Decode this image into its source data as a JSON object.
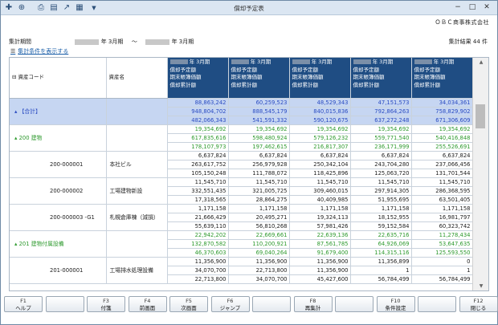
{
  "window": {
    "title": "償却予定表",
    "company": "ＯＢＣ商事株式会社"
  },
  "toolbar": {
    "icons": [
      "add-icon",
      "zoom-icon",
      "print-icon",
      "export-icon",
      "chart-icon",
      "settings-icon",
      "menu-icon"
    ]
  },
  "period": {
    "label": "集計期間",
    "from_suffix": "年  3月期",
    "separator": "～",
    "to_suffix": "年  3月期"
  },
  "result_count": "集計結果 44 件",
  "condition_link": "集計条件を表示する",
  "columns": {
    "code": "資産コード",
    "name": "資産名",
    "period_header": "年  3月期",
    "line1": "償却予定額",
    "line2": "期末帳簿価額",
    "line3": "償却累計額"
  },
  "rows": [
    {
      "type": "total",
      "code": "【合計】",
      "name": "",
      "values": [
        [
          "88,863,242",
          "60,259,523",
          "48,529,343",
          "47,151,573",
          "34,034,361"
        ],
        [
          "948,804,702",
          "888,545,179",
          "840,015,836",
          "792,864,263",
          "758,829,902"
        ],
        [
          "482,066,343",
          "541,591,332",
          "590,120,675",
          "637,272,248",
          "671,306,609"
        ]
      ]
    },
    {
      "type": "grp",
      "code": "200 建物",
      "name": "",
      "values": [
        [
          "19,354,692",
          "19,354,692",
          "19,354,692",
          "19,354,692",
          "19,354,692"
        ],
        [
          "617,835,616",
          "598,480,924",
          "579,126,232",
          "559,771,540",
          "540,416,848"
        ],
        [
          "178,107,973",
          "197,462,615",
          "216,817,307",
          "236,171,999",
          "255,526,691"
        ]
      ]
    },
    {
      "type": "item",
      "code": "200-000001",
      "name": "本社ビル",
      "values": [
        [
          "6,637,824",
          "6,637,824",
          "6,637,824",
          "6,637,824",
          "6,637,824"
        ],
        [
          "263,617,752",
          "256,979,928",
          "250,342,104",
          "243,704,280",
          "237,066,456"
        ],
        [
          "105,150,248",
          "111,788,072",
          "118,425,896",
          "125,063,720",
          "131,701,544"
        ]
      ]
    },
    {
      "type": "item",
      "code": "200-000002",
      "name": "工場建物新設",
      "values": [
        [
          "11,545,710",
          "11,545,710",
          "11,545,710",
          "11,545,710",
          "11,545,710"
        ],
        [
          "332,551,435",
          "321,005,725",
          "309,460,015",
          "297,914,305",
          "286,368,595"
        ],
        [
          "17,318,565",
          "28,864,275",
          "40,409,985",
          "51,955,695",
          "63,501,405"
        ]
      ]
    },
    {
      "type": "item",
      "code": "200-000003 -G1",
      "name": "札幌倉庫棟（減損）",
      "values": [
        [
          "1,171,158",
          "1,171,158",
          "1,171,158",
          "1,171,158",
          "1,171,158"
        ],
        [
          "21,666,429",
          "20,495,271",
          "19,324,113",
          "18,152,955",
          "16,981,797"
        ],
        [
          "55,639,110",
          "56,810,268",
          "57,981,426",
          "59,152,584",
          "60,323,742"
        ]
      ]
    },
    {
      "type": "grp",
      "code": "201 建物付属設備",
      "name": "",
      "values": [
        [
          "22,942,202",
          "22,669,661",
          "22,639,136",
          "22,635,716",
          "11,278,434"
        ],
        [
          "132,870,582",
          "110,200,921",
          "87,561,785",
          "64,926,069",
          "53,647,635"
        ],
        [
          "46,370,603",
          "69,040,264",
          "91,679,400",
          "114,315,116",
          "125,593,550"
        ]
      ]
    },
    {
      "type": "item",
      "code": "201-000001",
      "name": "工場排水処理設備",
      "values": [
        [
          "11,356,900",
          "11,356,900",
          "11,356,900",
          "11,356,899",
          "0"
        ],
        [
          "34,070,700",
          "22,713,800",
          "11,356,900",
          "1",
          "1"
        ],
        [
          "22,713,800",
          "34,070,700",
          "45,427,600",
          "56,784,499",
          "56,784,499"
        ]
      ]
    }
  ],
  "function_keys": [
    {
      "key": "F1",
      "label": "ヘルプ"
    },
    {
      "key": "",
      "label": ""
    },
    {
      "key": "F3",
      "label": "付箋"
    },
    {
      "key": "F4",
      "label": "前画面"
    },
    {
      "key": "F5",
      "label": "次画面"
    },
    {
      "key": "F6",
      "label": "ジャンプ"
    },
    {
      "key": "",
      "label": ""
    },
    {
      "key": "F8",
      "label": "再集計"
    },
    {
      "key": "",
      "label": ""
    },
    {
      "key": "F10",
      "label": "条件設定"
    },
    {
      "key": "",
      "label": ""
    },
    {
      "key": "F12",
      "label": "閉じる"
    }
  ]
}
